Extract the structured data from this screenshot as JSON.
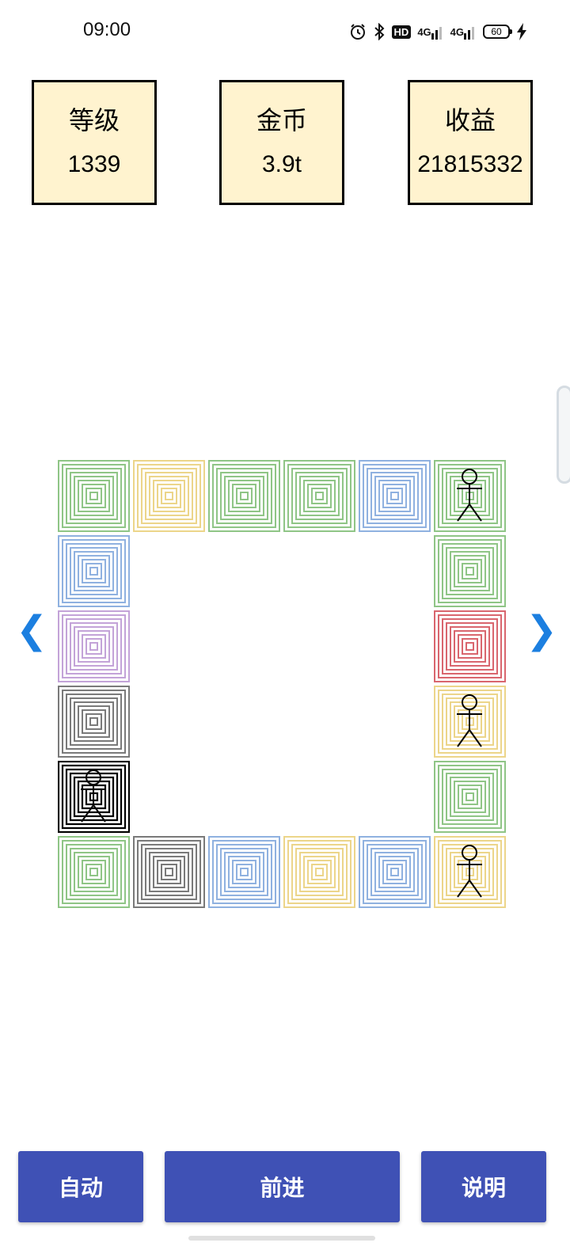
{
  "status_bar": {
    "time": "09:00",
    "icons": [
      "alarm-icon",
      "bluetooth-icon",
      "hd-icon",
      "signal-4g-icon",
      "signal-4g-icon",
      "battery-icon",
      "charging-icon"
    ],
    "hd_label": "HD",
    "net1": "4G",
    "net2": "4G",
    "battery_level": "60"
  },
  "stats": [
    {
      "label": "等级",
      "value": "1339"
    },
    {
      "label": "金币",
      "value": "3.9t"
    },
    {
      "label": "收益",
      "value": "21815332"
    }
  ],
  "colors": {
    "stat_bg": "#fff3cf",
    "button_bg": "#3f51b5",
    "arrow": "#1c7fe0",
    "green": "#8fc586",
    "yellow": "#ecd58a",
    "blue": "#8fb1e0",
    "purple": "#c3a3d8",
    "gray": "#7a7a7a",
    "black": "#000000",
    "red": "#d9666e"
  },
  "board": {
    "tiles": [
      {
        "color": "green",
        "figure": false
      },
      {
        "color": "yellow",
        "figure": false
      },
      {
        "color": "green",
        "figure": false
      },
      {
        "color": "green",
        "figure": false
      },
      {
        "color": "blue",
        "figure": false
      },
      {
        "color": "green",
        "figure": true
      },
      {
        "color": "green",
        "figure": false
      },
      {
        "color": "red",
        "figure": false
      },
      {
        "color": "yellow",
        "figure": true
      },
      {
        "color": "green",
        "figure": false
      },
      {
        "color": "yellow",
        "figure": true
      },
      {
        "color": "blue",
        "figure": false
      },
      {
        "color": "yellow",
        "figure": false
      },
      {
        "color": "blue",
        "figure": false
      },
      {
        "color": "gray",
        "figure": false
      },
      {
        "color": "green",
        "figure": false
      },
      {
        "color": "black",
        "figure": true
      },
      {
        "color": "gray",
        "figure": false
      },
      {
        "color": "purple",
        "figure": false
      },
      {
        "color": "blue",
        "figure": false
      }
    ]
  },
  "nav": {
    "prev_label": "❮",
    "next_label": "❯"
  },
  "actions": {
    "auto_label": "自动",
    "forward_label": "前进",
    "help_label": "说明"
  }
}
